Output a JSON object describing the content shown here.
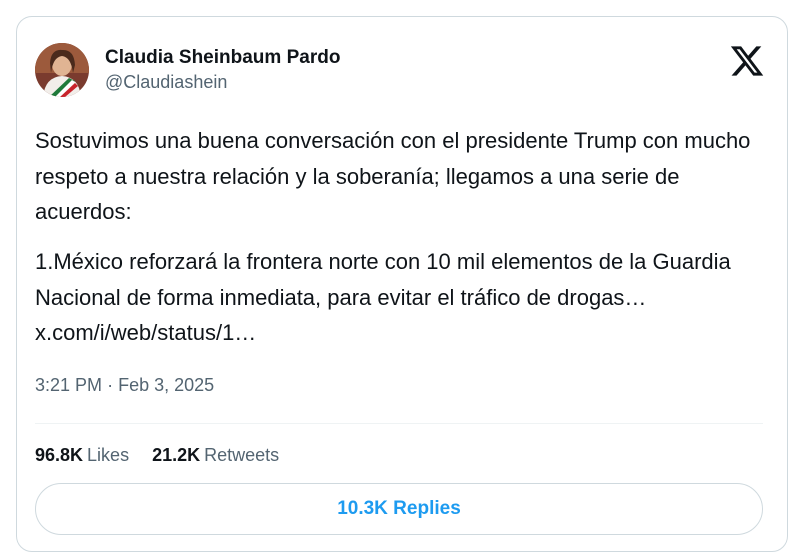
{
  "author": {
    "name": "Claudia Sheinbaum Pardo",
    "handle": "@Claudiashein",
    "avatar_icon": "profile-photo"
  },
  "logo": "x-logo-icon",
  "tweet": {
    "paragraph1": "Sostuvimos una buena conversación con el presidente Trump con mucho respeto a nuestra relación y la soberanía; llegamos a una serie de acuerdos:",
    "paragraph2_text": "1.México reforzará la frontera norte con 10 mil elementos de la Guardia Nacional de forma inmediata, para evitar el tráfico de drogas… ",
    "paragraph2_link": "x.com/i/web/status/1…"
  },
  "timestamp": {
    "time": "3:21 PM",
    "separator": "·",
    "date": "Feb 3, 2025"
  },
  "stats": {
    "likes_count": "96.8K",
    "likes_label": "Likes",
    "retweets_count": "21.2K",
    "retweets_label": "Retweets"
  },
  "replies_button": "10.3K Replies",
  "colors": {
    "accent": "#1d9bf0",
    "text": "#0f1419",
    "muted": "#536471",
    "border": "#cfd9de"
  }
}
